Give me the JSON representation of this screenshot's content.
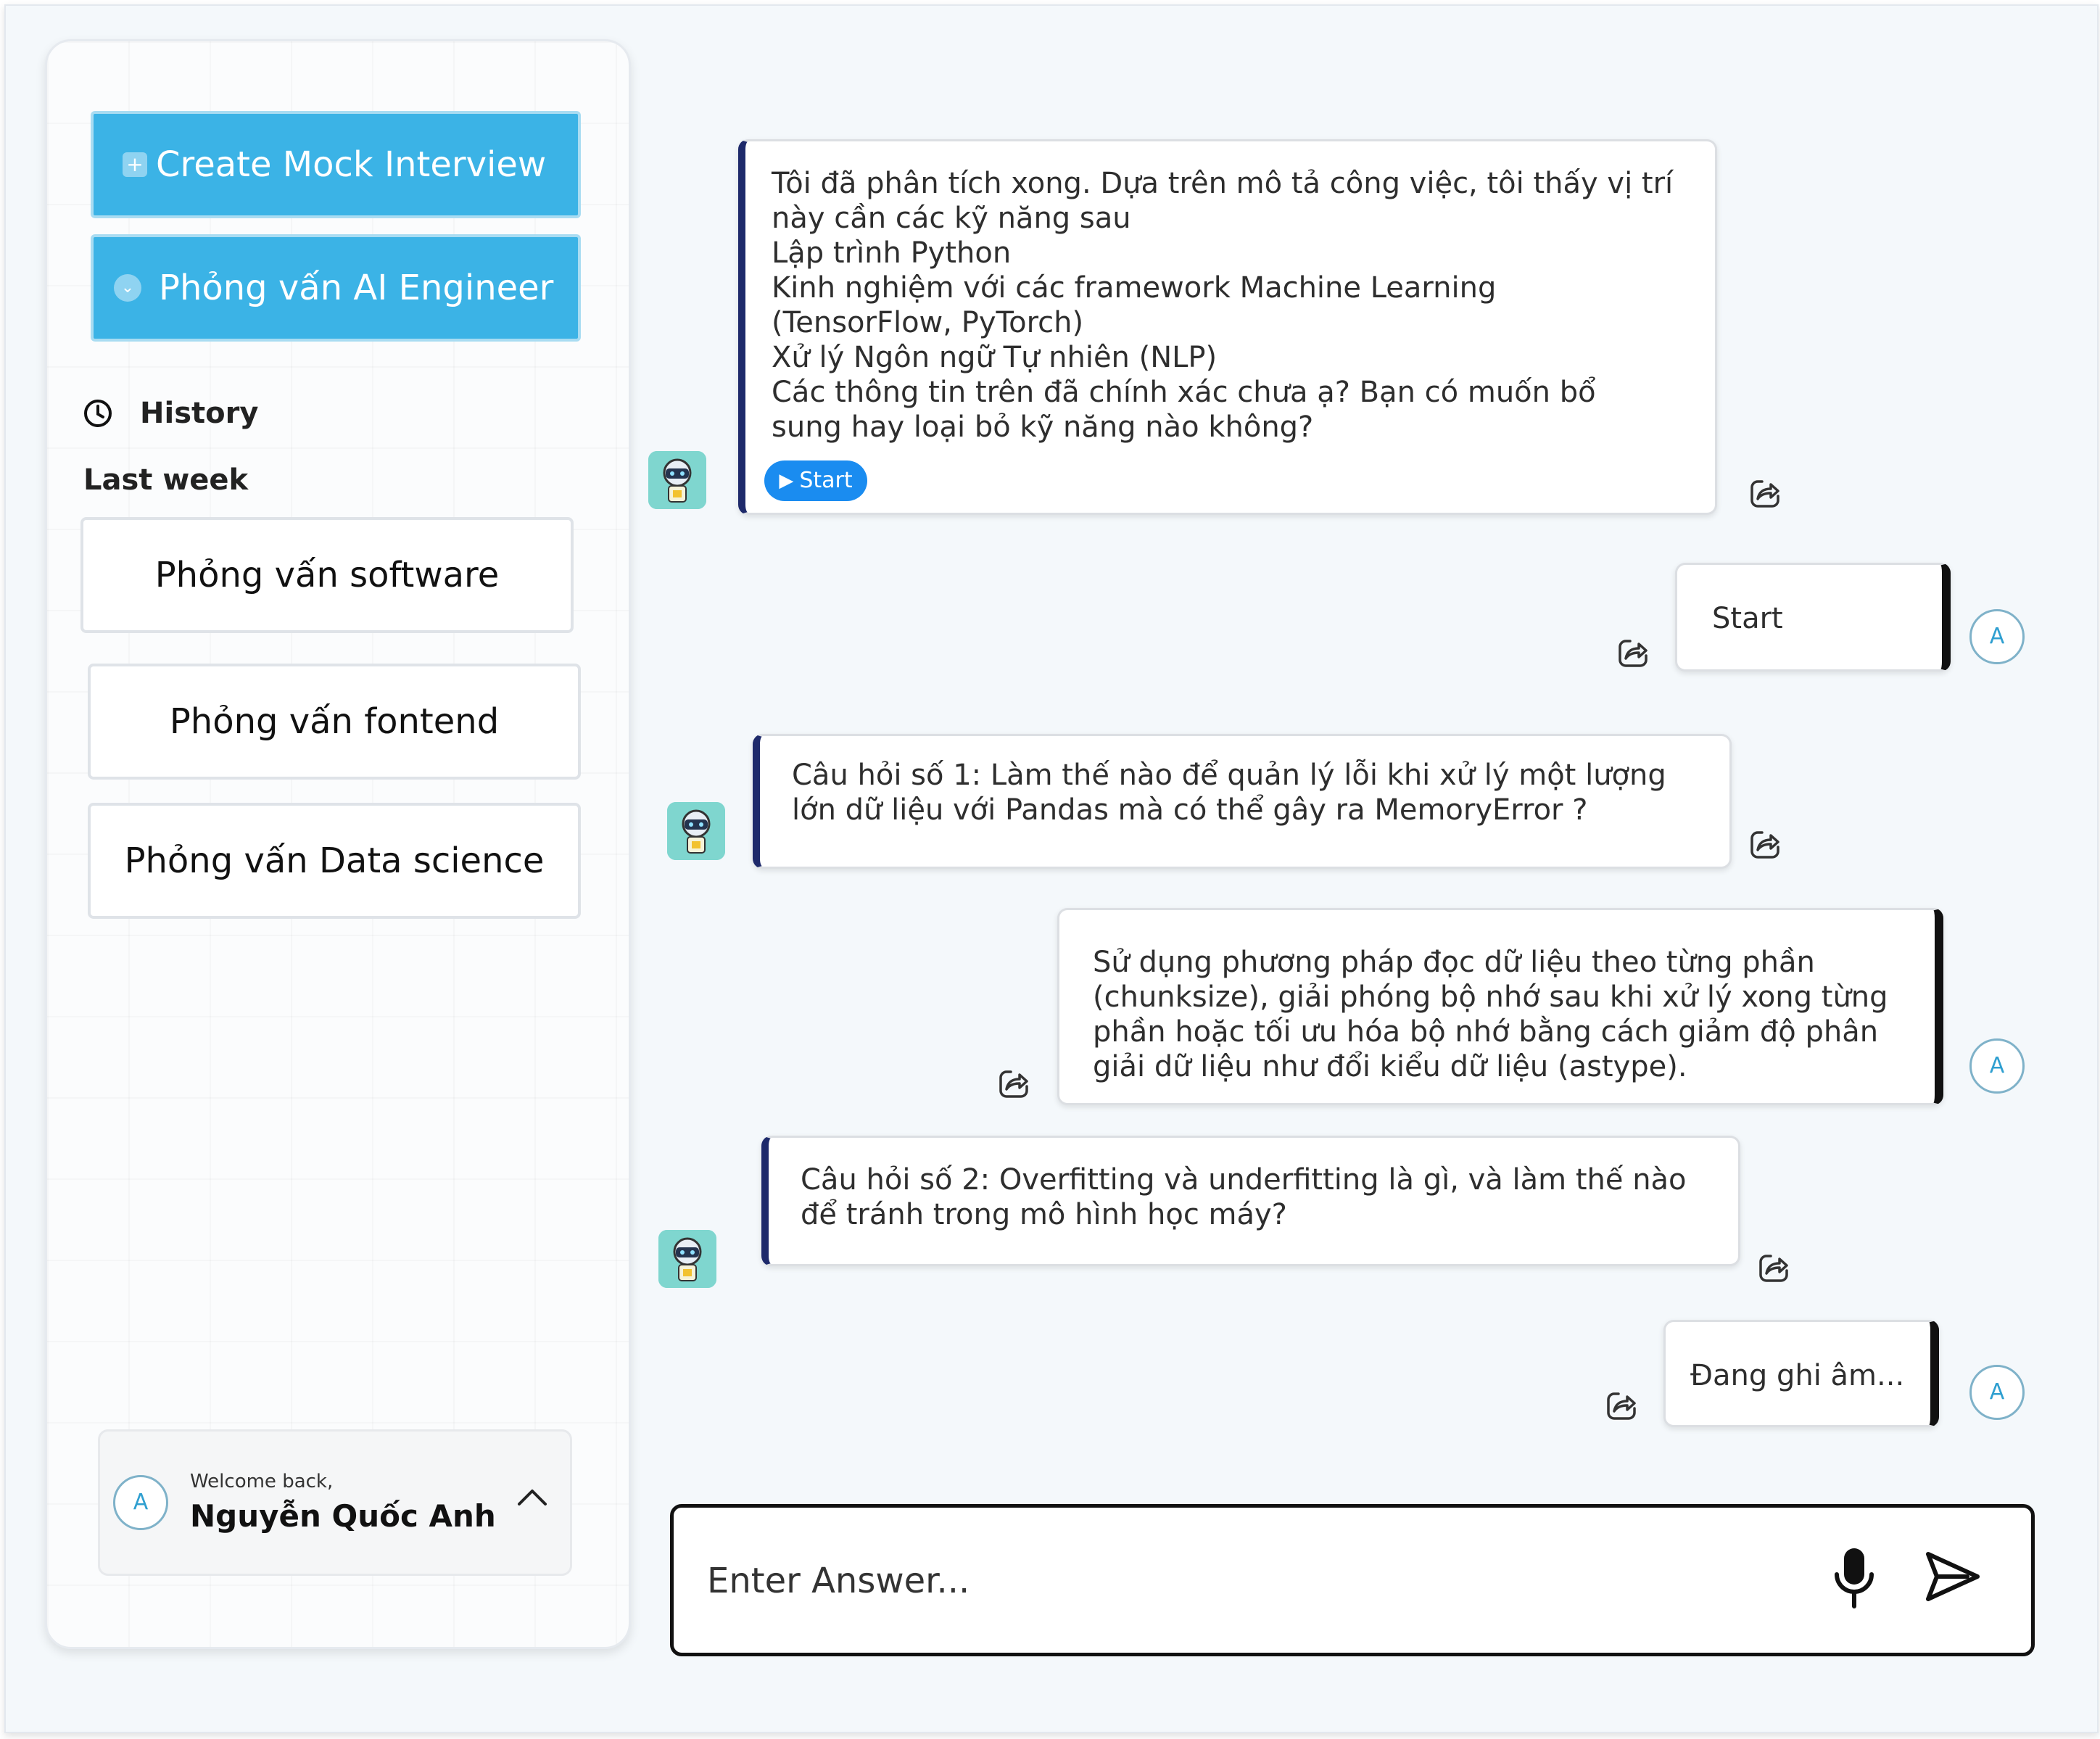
{
  "sidebar": {
    "create_label": "Create Mock Interview",
    "current_interview_label": "Phỏng vấn AI Engineer",
    "history_label": "History",
    "section_label": "Last week",
    "history_items": [
      {
        "label": "Phỏng vấn software"
      },
      {
        "label": "Phỏng vấn fontend"
      },
      {
        "label": "Phỏng vấn Data science"
      }
    ]
  },
  "user": {
    "avatar_initial": "A",
    "welcome": "Welcome back,",
    "name": "Nguyễn Quốc Anh"
  },
  "messages": {
    "m1": {
      "lines": [
        "Tôi đã phân tích xong. Dựa trên mô tả công việc, tôi thấy vị trí",
        "này cần các kỹ năng sau",
        "Lập trình Python",
        "Kinh nghiệm với các framework Machine Learning",
        "(TensorFlow, PyTorch)",
        "Xử lý Ngôn ngữ Tự nhiên (NLP)",
        "Các thông tin trên đã chính xác chưa ạ? Bạn có muốn bổ",
        "sung hay loại bỏ kỹ năng nào không?"
      ],
      "chip": "Start"
    },
    "m2": {
      "lines": [
        "Start"
      ]
    },
    "m3": {
      "lines": [
        "Câu hỏi số 1: Làm thế nào để quản lý lỗi khi xử lý một lượng",
        "lớn dữ liệu với Pandas mà có thể gây ra MemoryError ?"
      ]
    },
    "m4": {
      "lines": [
        "Sử dụng phương pháp đọc dữ liệu theo từng phần",
        "(chunksize), giải phóng bộ nhớ sau khi xử lý xong từng",
        "phần hoặc tối ưu hóa bộ nhớ bằng cách giảm độ phân",
        "giải dữ liệu như đổi kiểu dữ liệu (astype)."
      ]
    },
    "m5": {
      "lines": [
        "Câu hỏi số 2: Overfitting và underfitting là gì, và làm thế nào",
        "để tránh trong mô hình học máy?"
      ]
    },
    "m6": {
      "lines": [
        "Đang ghi âm..."
      ]
    }
  },
  "composer": {
    "placeholder": "Enter Answer..."
  },
  "colors": {
    "primary": "#3bb3e6",
    "chip": "#1a8cf0",
    "bot_accent": "#1e2a6b",
    "user_accent": "#111111",
    "background": "#f4f8fb"
  },
  "icons": [
    "plus-icon",
    "chevron-down-icon",
    "clock-icon",
    "chevron-up-icon",
    "share-icon",
    "bot-avatar-icon",
    "microphone-icon",
    "send-icon",
    "play-icon"
  ]
}
